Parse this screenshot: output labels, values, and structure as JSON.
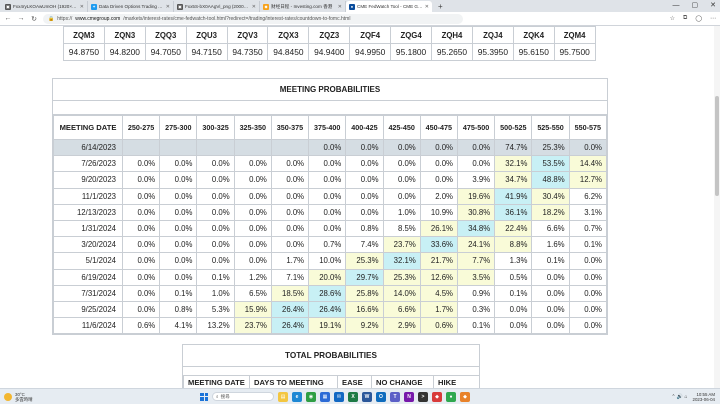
{
  "browser": {
    "tabs": [
      {
        "label": "Fxx4ryLKOAwUmOH (1920×1920)",
        "icon_color": "#555555",
        "icon_glyph": "▣",
        "active": false
      },
      {
        "label": "Data Driven Options Trading Ac...",
        "icon_color": "#1d9bf0",
        "icon_glyph": "✦",
        "active": false
      },
      {
        "label": "Fxx5S-bX0AAgVi_png (2000×1000)",
        "icon_color": "#555555",
        "icon_glyph": "▣",
        "active": false
      },
      {
        "label": "财经日程 - Investing.com 香港",
        "icon_color": "#f7a21b",
        "icon_glyph": "◆",
        "active": false
      },
      {
        "label": "CME FedWatch Tool - CME Group",
        "icon_color": "#0a4c9c",
        "icon_glyph": "●",
        "active": true
      }
    ],
    "new_tab": "+",
    "url_host": "www.cmegroup.com",
    "url_path": "/markets/interest-rates/cme-fedwatch-tool.html?redirect=/trading/interest-rates/countdown-to-fomc.html",
    "url_scheme": "https://"
  },
  "futures": {
    "headers": [
      "ZQM3",
      "ZQN3",
      "ZQQ3",
      "ZQU3",
      "ZQV3",
      "ZQX3",
      "ZQZ3",
      "ZQF4",
      "ZQG4",
      "ZQH4",
      "ZQJ4",
      "ZQK4",
      "ZQM4"
    ],
    "values": [
      "94.8750",
      "94.8200",
      "94.7050",
      "94.7150",
      "94.7350",
      "94.8450",
      "94.9400",
      "94.9950",
      "95.1800",
      "95.2650",
      "95.3950",
      "95.6150",
      "95.7500"
    ]
  },
  "meeting_probabilities": {
    "title": "MEETING PROBABILITIES",
    "date_header": "MEETING DATE",
    "range_headers": [
      "250-275",
      "275-300",
      "300-325",
      "325-350",
      "350-375",
      "375-400",
      "400-425",
      "425-450",
      "450-475",
      "475-500",
      "500-525",
      "525-550",
      "550-575"
    ],
    "rows": [
      {
        "date": "6/14/2023",
        "cells": [
          "",
          "",
          "",
          "",
          "",
          "0.0%",
          "0.0%",
          "0.0%",
          "0.0%",
          "0.0%",
          "74.7%",
          "25.3%",
          "0.0%"
        ]
      },
      {
        "date": "7/26/2023",
        "cells": [
          "0.0%",
          "0.0%",
          "0.0%",
          "0.0%",
          "0.0%",
          "0.0%",
          "0.0%",
          "0.0%",
          "0.0%",
          "0.0%",
          "32.1%",
          "53.5%",
          "14.4%"
        ]
      },
      {
        "date": "9/20/2023",
        "cells": [
          "0.0%",
          "0.0%",
          "0.0%",
          "0.0%",
          "0.0%",
          "0.0%",
          "0.0%",
          "0.0%",
          "0.0%",
          "3.9%",
          "34.7%",
          "48.8%",
          "12.7%"
        ]
      },
      {
        "date": "11/1/2023",
        "cells": [
          "0.0%",
          "0.0%",
          "0.0%",
          "0.0%",
          "0.0%",
          "0.0%",
          "0.0%",
          "0.0%",
          "2.0%",
          "19.6%",
          "41.9%",
          "30.4%",
          "6.2%"
        ]
      },
      {
        "date": "12/13/2023",
        "cells": [
          "0.0%",
          "0.0%",
          "0.0%",
          "0.0%",
          "0.0%",
          "0.0%",
          "0.0%",
          "1.0%",
          "10.9%",
          "30.8%",
          "36.1%",
          "18.2%",
          "3.1%"
        ]
      },
      {
        "date": "1/31/2024",
        "cells": [
          "0.0%",
          "0.0%",
          "0.0%",
          "0.0%",
          "0.0%",
          "0.0%",
          "0.8%",
          "8.5%",
          "26.1%",
          "34.8%",
          "22.4%",
          "6.6%",
          "0.7%"
        ]
      },
      {
        "date": "3/20/2024",
        "cells": [
          "0.0%",
          "0.0%",
          "0.0%",
          "0.0%",
          "0.0%",
          "0.7%",
          "7.4%",
          "23.7%",
          "33.6%",
          "24.1%",
          "8.8%",
          "1.6%",
          "0.1%"
        ]
      },
      {
        "date": "5/1/2024",
        "cells": [
          "0.0%",
          "0.0%",
          "0.0%",
          "0.0%",
          "1.7%",
          "10.0%",
          "25.3%",
          "32.1%",
          "21.7%",
          "7.7%",
          "1.3%",
          "0.1%",
          "0.0%"
        ]
      },
      {
        "date": "6/19/2024",
        "cells": [
          "0.0%",
          "0.0%",
          "0.1%",
          "1.2%",
          "7.1%",
          "20.0%",
          "29.7%",
          "25.3%",
          "12.6%",
          "3.5%",
          "0.5%",
          "0.0%",
          "0.0%"
        ]
      },
      {
        "date": "7/31/2024",
        "cells": [
          "0.0%",
          "0.1%",
          "1.0%",
          "6.5%",
          "18.5%",
          "28.6%",
          "25.8%",
          "14.0%",
          "4.5%",
          "0.9%",
          "0.1%",
          "0.0%",
          "0.0%"
        ]
      },
      {
        "date": "9/25/2024",
        "cells": [
          "0.0%",
          "0.8%",
          "5.3%",
          "15.9%",
          "26.4%",
          "26.4%",
          "16.6%",
          "6.6%",
          "1.7%",
          "0.3%",
          "0.0%",
          "0.0%",
          "0.0%"
        ]
      },
      {
        "date": "11/6/2024",
        "cells": [
          "0.6%",
          "4.1%",
          "13.2%",
          "23.7%",
          "26.4%",
          "19.1%",
          "9.2%",
          "2.9%",
          "0.6%",
          "0.1%",
          "0.0%",
          "0.0%",
          "0.0%"
        ]
      }
    ],
    "highlight_blue": [
      [
        0,
        10
      ],
      [
        1,
        11
      ],
      [
        2,
        11
      ],
      [
        3,
        10
      ],
      [
        4,
        10
      ],
      [
        5,
        9
      ],
      [
        6,
        8
      ],
      [
        7,
        7
      ],
      [
        8,
        6
      ],
      [
        9,
        5
      ],
      [
        10,
        4
      ],
      [
        10,
        5
      ],
      [
        11,
        4
      ]
    ],
    "highlight_yellow": [
      [
        0,
        11
      ],
      [
        1,
        10
      ],
      [
        1,
        12
      ],
      [
        2,
        10
      ],
      [
        2,
        12
      ],
      [
        3,
        9
      ],
      [
        3,
        11
      ],
      [
        4,
        9
      ],
      [
        4,
        11
      ],
      [
        5,
        8
      ],
      [
        5,
        10
      ],
      [
        6,
        7
      ],
      [
        6,
        9
      ],
      [
        6,
        10
      ],
      [
        7,
        6
      ],
      [
        7,
        8
      ],
      [
        7,
        9
      ],
      [
        8,
        5
      ],
      [
        8,
        7
      ],
      [
        8,
        8
      ],
      [
        8,
        9
      ],
      [
        9,
        4
      ],
      [
        9,
        6
      ],
      [
        9,
        7
      ],
      [
        9,
        8
      ],
      [
        10,
        3
      ],
      [
        10,
        6
      ],
      [
        10,
        7
      ],
      [
        10,
        8
      ],
      [
        11,
        3
      ],
      [
        11,
        5
      ],
      [
        11,
        6
      ],
      [
        11,
        7
      ],
      [
        11,
        8
      ]
    ],
    "colors": {
      "row_gray": "#d5dde3",
      "blue": "#c8f0f5",
      "yellow": "#f9fbd8"
    }
  },
  "total_probabilities": {
    "title": "TOTAL PROBABILITIES",
    "headers": [
      "MEETING DATE",
      "DAYS TO MEETING",
      "EASE",
      "NO CHANGE",
      "HIKE"
    ]
  },
  "taskbar": {
    "weather_temp": "30°C",
    "weather_desc": "多雲時晴",
    "search_placeholder": "搜尋",
    "time": "10:55 AM",
    "date": "2023-06-04",
    "apps": [
      {
        "name": "file-explorer",
        "color": "#f3c641",
        "glyph": "▤"
      },
      {
        "name": "edge",
        "color": "#1e88d4",
        "glyph": "e"
      },
      {
        "name": "chrome",
        "color": "#2f9e44",
        "glyph": "◉"
      },
      {
        "name": "store",
        "color": "#2c6bd6",
        "glyph": "▦"
      },
      {
        "name": "mail",
        "color": "#1268c3",
        "glyph": "✉"
      },
      {
        "name": "excel",
        "color": "#1d7a45",
        "glyph": "X"
      },
      {
        "name": "word",
        "color": "#2b579a",
        "glyph": "W"
      },
      {
        "name": "outlook",
        "color": "#0f6cbd",
        "glyph": "O"
      },
      {
        "name": "teams",
        "color": "#5b5fc7",
        "glyph": "T"
      },
      {
        "name": "onenote",
        "color": "#7719aa",
        "glyph": "N"
      },
      {
        "name": "terminal",
        "color": "#333333",
        "glyph": ">"
      },
      {
        "name": "app-red",
        "color": "#d83b3b",
        "glyph": "◆"
      },
      {
        "name": "app-green",
        "color": "#2fa84f",
        "glyph": "●"
      },
      {
        "name": "app-orange",
        "color": "#e8822a",
        "glyph": "◆"
      }
    ]
  }
}
